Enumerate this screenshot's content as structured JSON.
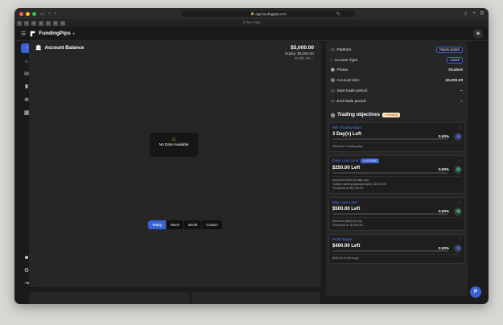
{
  "browser": {
    "url": "app.fundingpips.com",
    "start_tab": "Start Page"
  },
  "app": {
    "name": "FundingPips",
    "trademark": "®"
  },
  "account_balance": {
    "title": "Account Balance",
    "balance": "$5,000.00",
    "equity": "Equity: $5,000.00",
    "profit": "Profit: 0% ↑",
    "no_data": "No Data Available",
    "ranges": [
      "Today",
      "Week",
      "Month",
      "Custom"
    ]
  },
  "details": {
    "platform_label": "Platform",
    "platform_value": "TRADELOCKER",
    "account_type_label": "Account Type",
    "account_type_value": "2 STEP",
    "phase_label": "Phase",
    "phase_value": "Student",
    "account_size_label": "Account size:",
    "account_size_value": "$5,000.00",
    "start_label": "Start trade period:",
    "start_value": "--",
    "end_label": "End trade period:",
    "end_value": "--"
  },
  "objectives": {
    "title": "Trading objectives",
    "status": "Pending",
    "cards": [
      {
        "title": "Min Trading Days",
        "badge": "",
        "value": "3 Day(s) Left",
        "pct": "0.00%",
        "progress": 0,
        "notes": [
          "Minimum 3 trading days"
        ],
        "dot": "#3a62d7"
      },
      {
        "title": "Daily Loss Limit",
        "badge": "01:26:20",
        "value": "$250.00 Left",
        "pct": "0.00%",
        "progress": 0,
        "notes": [
          "Maximum $250.00 daily loss",
          "Today's starting balance/equity: $5,000.00",
          "Threshold at: $4,750.00"
        ],
        "dot": "#2fa361"
      },
      {
        "title": "Max Loss Limit",
        "badge": "",
        "value": "$500.00 Left",
        "pct": "0.00%",
        "progress": 0,
        "notes": [
          "Maximum $500.00 loss",
          "Threshold at: $4,500.00"
        ],
        "dot": "#2fa361"
      },
      {
        "title": "Profit Target",
        "badge": "",
        "value": "$400.00 Left",
        "pct": "0.00%",
        "progress": 0,
        "notes": [
          "$400.00 Profit target"
        ],
        "dot": "#3a62d7"
      }
    ]
  }
}
